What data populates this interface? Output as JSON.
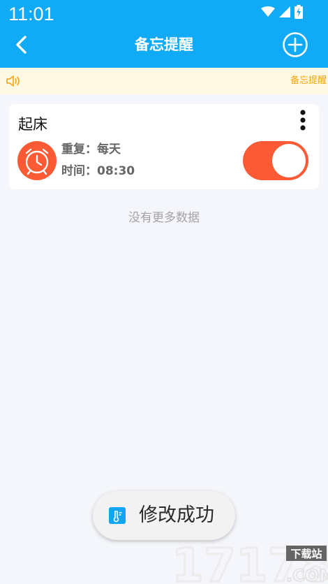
{
  "status_bar": {
    "time": "11:01",
    "icons": [
      "wifi-icon",
      "signal-icon",
      "battery-charging-icon"
    ]
  },
  "app_bar": {
    "title": "备忘提醒",
    "back_icon": "chevron-left-icon",
    "add_icon": "add-circle-icon"
  },
  "notice": {
    "icon": "speaker-icon",
    "text": "备忘提醒"
  },
  "reminders": [
    {
      "title": "起床",
      "icon": "alarm-clock-icon",
      "repeat_label": "重复：",
      "repeat_value": "每天",
      "time_label": "时间：",
      "time_value": "08:30",
      "enabled": true
    }
  ],
  "list_footer": "没有更多数据",
  "toast": {
    "icon": "app-icon",
    "text": "修改成功"
  },
  "watermark": {
    "logo": "17178",
    "subtitle": "下载站",
    "domain": ".COM"
  },
  "colors": {
    "primary": "#11aaf6",
    "accent": "#fb5a34",
    "notice_bg": "#fff8e4",
    "notice_text": "#f6a40f",
    "page_bg": "#f4f6fb"
  }
}
